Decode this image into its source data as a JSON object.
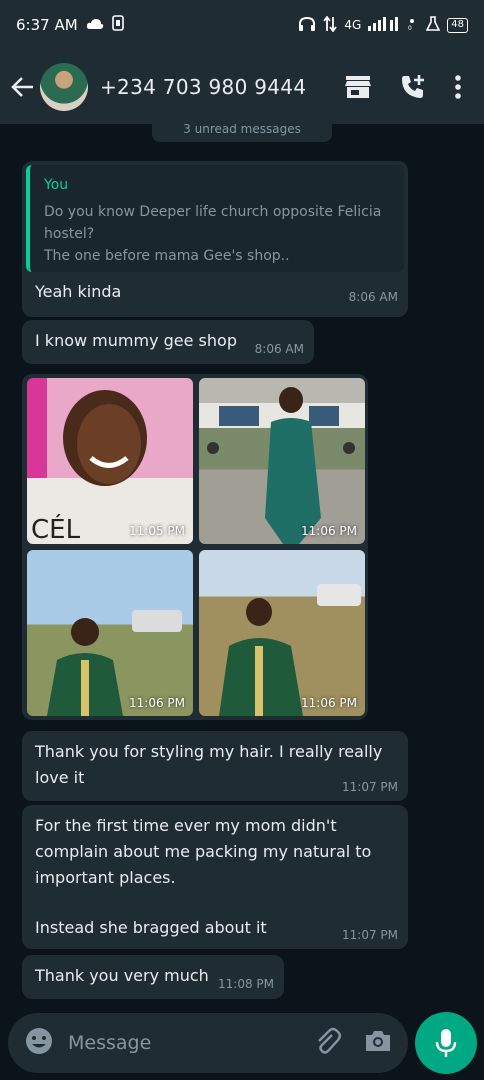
{
  "status_bar": {
    "time": "6:37 AM",
    "network": "4G",
    "battery": "48"
  },
  "header": {
    "contact": "+234 703 980 9444"
  },
  "chat": {
    "date_chip": "3 unread messages",
    "messages": [
      {
        "quote_author": "You",
        "quote_line1": "Do you know Deeper life church opposite Felicia",
        "quote_line2": "hostel?",
        "quote_line3": "The one before mama Gee's shop..",
        "text": "Yeah kinda",
        "time": "8:06 AM"
      },
      {
        "text": "I know mummy gee shop",
        "time": "8:06 AM"
      },
      {
        "photos": [
          {
            "time": "11:05 PM"
          },
          {
            "time": "11:06 PM"
          },
          {
            "time": "11:06 PM"
          },
          {
            "time": "11:06 PM"
          }
        ]
      },
      {
        "line1": "Thank you for styling my hair. I really really",
        "line2": "love it",
        "time": "11:07 PM"
      },
      {
        "line1": "For the first time ever my mom didn't",
        "line2": "complain about me packing my natural to",
        "line3": "important places.",
        "line4": "Instead she bragged about it",
        "time": "11:07 PM"
      },
      {
        "text": "Thank you very much",
        "time": "11:08 PM"
      }
    ]
  },
  "composer": {
    "placeholder": "Message"
  },
  "colors": {
    "accent": "#00a884",
    "quote_author": "#06cf9c",
    "bubble": "#1f2c34",
    "background": "#0b141a"
  }
}
